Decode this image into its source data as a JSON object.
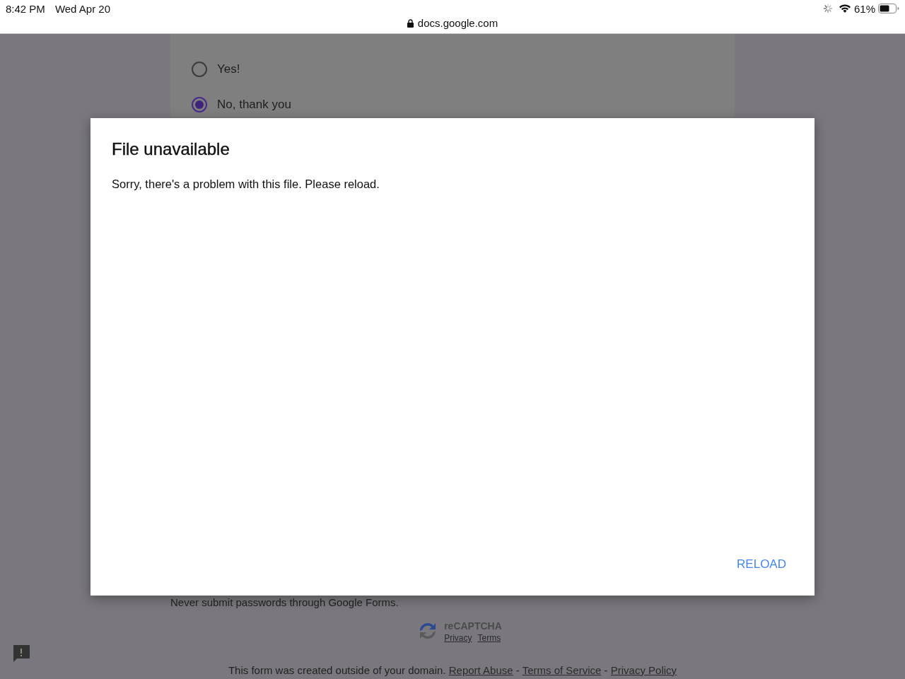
{
  "status_bar": {
    "time": "8:42 PM",
    "date": "Wed Apr 20",
    "url": "docs.google.com",
    "battery": "61%"
  },
  "form": {
    "options": [
      {
        "label": "Yes!",
        "selected": false
      },
      {
        "label": "No, thank you",
        "selected": true
      }
    ],
    "warning": "Never submit passwords through Google Forms.",
    "recaptcha": {
      "title": "reCAPTCHA",
      "links": [
        "Privacy",
        "Terms"
      ]
    },
    "footer": [
      {
        "kind": "text",
        "text": "This form was created outside of your domain. "
      },
      {
        "kind": "link",
        "text": "Report Abuse"
      },
      {
        "kind": "text",
        "text": " - "
      },
      {
        "kind": "link",
        "text": "Terms of Service"
      },
      {
        "kind": "text",
        "text": " - "
      },
      {
        "kind": "link",
        "text": "Privacy Policy"
      }
    ]
  },
  "dialog": {
    "title": "File unavailable",
    "message": "Sorry, there's a problem with this file. Please reload.",
    "button": "RELOAD"
  }
}
